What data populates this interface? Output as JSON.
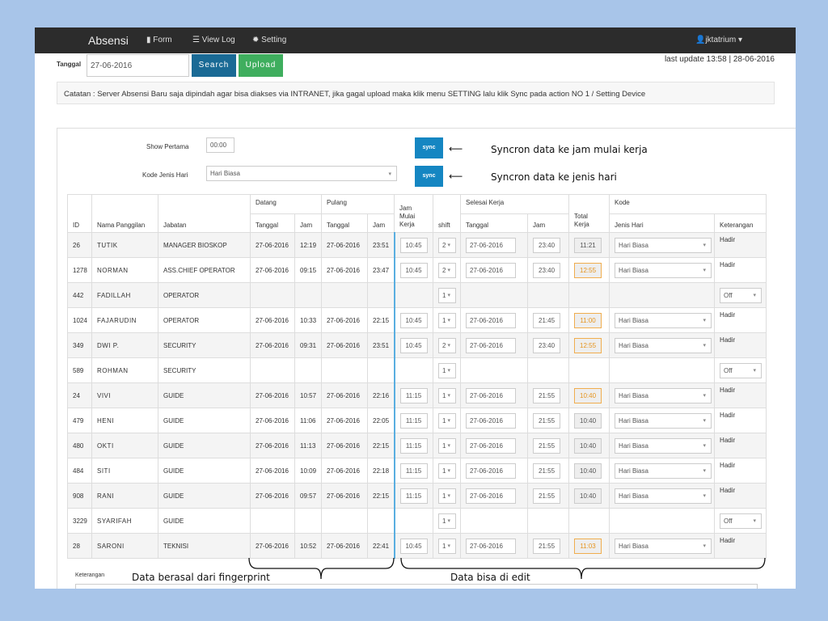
{
  "nav": {
    "brand": "Absensi",
    "items": [
      {
        "label": "Form",
        "icon": "file-icon"
      },
      {
        "label": "View Log",
        "icon": "list-icon"
      },
      {
        "label": "Setting",
        "icon": "gear-icon"
      }
    ],
    "user": "jktatrium"
  },
  "toolbar": {
    "date_label": "Tanggal",
    "date_value": "27-06-2016",
    "search_label": "Search",
    "upload_label": "Upload",
    "last_update": "last update 13:58 | 28-06-2016"
  },
  "note": "Catatan : Server Absensi Baru saja dipindah agar bisa diakses via INTRANET, jika gagal upload maka klik menu SETTING lalu klik Sync pada action NO 1 / Setting Device",
  "settings": {
    "show_label": "Show Pertama",
    "show_value": "00:00",
    "kode_label": "Kode Jenis Hari",
    "kode_value": "Hari Biasa",
    "sync_label": "sync"
  },
  "colors": {
    "search": "#1a6a95",
    "upload": "#3fae5e",
    "sync": "#1586c2",
    "warn": "#f0ad4e"
  },
  "table": {
    "group_headers": {
      "datang": "Datang",
      "pulang": "Pulang",
      "jam_mulai": "Jam Mulai Kerja",
      "selesai": "Selesai Kerja",
      "total": "Total Kerja",
      "kode": "Kode"
    },
    "headers": {
      "id": "ID",
      "nama": "Nama Panggilan",
      "jabatan": "Jabatan",
      "tanggal": "Tanggal",
      "jam": "Jam",
      "shift": "shift",
      "jenis": "Jenis Hari",
      "ket": "Keterangan"
    },
    "rows": [
      {
        "id": "26",
        "nama": "TUTIK",
        "jabatan": "MANAGER BIOSKOP",
        "dt": "27-06-2016",
        "dj": "12:19",
        "pt": "27-06-2016",
        "pj": "23:51",
        "mulai": "10:45",
        "shift": "2",
        "st": "27-06-2016",
        "sj": "23:40",
        "total": "11:21",
        "warn": false,
        "jenis": "Hari Biasa",
        "ket": "Hadir"
      },
      {
        "id": "1278",
        "nama": "NORMAN",
        "jabatan": "ASS.CHIEF OPERATOR",
        "dt": "27-06-2016",
        "dj": "09:15",
        "pt": "27-06-2016",
        "pj": "23:47",
        "mulai": "10:45",
        "shift": "2",
        "st": "27-06-2016",
        "sj": "23:40",
        "total": "12:55",
        "warn": true,
        "jenis": "Hari Biasa",
        "ket": "Hadir"
      },
      {
        "id": "442",
        "nama": "FADILLAH",
        "jabatan": "OPERATOR",
        "shift": "1",
        "ket_select": "Off"
      },
      {
        "id": "1024",
        "nama": "FAJARUDIN",
        "jabatan": "OPERATOR",
        "dt": "27-06-2016",
        "dj": "10:33",
        "pt": "27-06-2016",
        "pj": "22:15",
        "mulai": "10:45",
        "shift": "1",
        "st": "27-06-2016",
        "sj": "21:45",
        "total": "11:00",
        "warn": true,
        "jenis": "Hari Biasa",
        "ket": "Hadir"
      },
      {
        "id": "349",
        "nama": "DWI P.",
        "jabatan": "SECURITY",
        "dt": "27-06-2016",
        "dj": "09:31",
        "pt": "27-06-2016",
        "pj": "23:51",
        "mulai": "10:45",
        "shift": "2",
        "st": "27-06-2016",
        "sj": "23:40",
        "total": "12:55",
        "warn": true,
        "jenis": "Hari Biasa",
        "ket": "Hadir"
      },
      {
        "id": "589",
        "nama": "ROHMAN",
        "jabatan": "SECURITY",
        "shift": "1",
        "ket_select": "Off"
      },
      {
        "id": "24",
        "nama": "VIVI",
        "jabatan": "GUIDE",
        "dt": "27-06-2016",
        "dj": "10:57",
        "pt": "27-06-2016",
        "pj": "22:16",
        "mulai": "11:15",
        "shift": "1",
        "st": "27-06-2016",
        "sj": "21:55",
        "total": "10:40",
        "warn": true,
        "jenis": "Hari Biasa",
        "ket": "Hadir"
      },
      {
        "id": "479",
        "nama": "HENI",
        "jabatan": "GUIDE",
        "dt": "27-06-2016",
        "dj": "11:06",
        "pt": "27-06-2016",
        "pj": "22:05",
        "mulai": "11:15",
        "shift": "1",
        "st": "27-06-2016",
        "sj": "21:55",
        "total": "10:40",
        "warn": false,
        "jenis": "Hari Biasa",
        "ket": "Hadir"
      },
      {
        "id": "480",
        "nama": "OKTI",
        "jabatan": "GUIDE",
        "dt": "27-06-2016",
        "dj": "11:13",
        "pt": "27-06-2016",
        "pj": "22:15",
        "mulai": "11:15",
        "shift": "1",
        "st": "27-06-2016",
        "sj": "21:55",
        "total": "10:40",
        "warn": false,
        "jenis": "Hari Biasa",
        "ket": "Hadir"
      },
      {
        "id": "484",
        "nama": "SITI",
        "jabatan": "GUIDE",
        "dt": "27-06-2016",
        "dj": "10:09",
        "pt": "27-06-2016",
        "pj": "22:18",
        "mulai": "11:15",
        "shift": "1",
        "st": "27-06-2016",
        "sj": "21:55",
        "total": "10:40",
        "warn": false,
        "jenis": "Hari Biasa",
        "ket": "Hadir"
      },
      {
        "id": "908",
        "nama": "RANI",
        "jabatan": "GUIDE",
        "dt": "27-06-2016",
        "dj": "09:57",
        "pt": "27-06-2016",
        "pj": "22:15",
        "mulai": "11:15",
        "shift": "1",
        "st": "27-06-2016",
        "sj": "21:55",
        "total": "10:40",
        "warn": false,
        "jenis": "Hari Biasa",
        "ket": "Hadir"
      },
      {
        "id": "3229",
        "nama": "SYARIFAH",
        "jabatan": "GUIDE",
        "shift": "1",
        "ket_select": "Off"
      },
      {
        "id": "28",
        "nama": "SARONI",
        "jabatan": "TEKNISI",
        "dt": "27-06-2016",
        "dj": "10:52",
        "pt": "27-06-2016",
        "pj": "22:41",
        "mulai": "10:45",
        "shift": "1",
        "st": "27-06-2016",
        "sj": "21:55",
        "total": "11:03",
        "warn": true,
        "jenis": "Hari Biasa",
        "ket": "Hadir"
      }
    ]
  },
  "keterangan_label": "Keterangan",
  "annotations": {
    "sync1": "Syncron data ke jam mulai kerja",
    "sync2": "Syncron data ke jenis hari",
    "fingerprint": "Data berasal dari fingerprint",
    "editable": "Data bisa di edit"
  }
}
